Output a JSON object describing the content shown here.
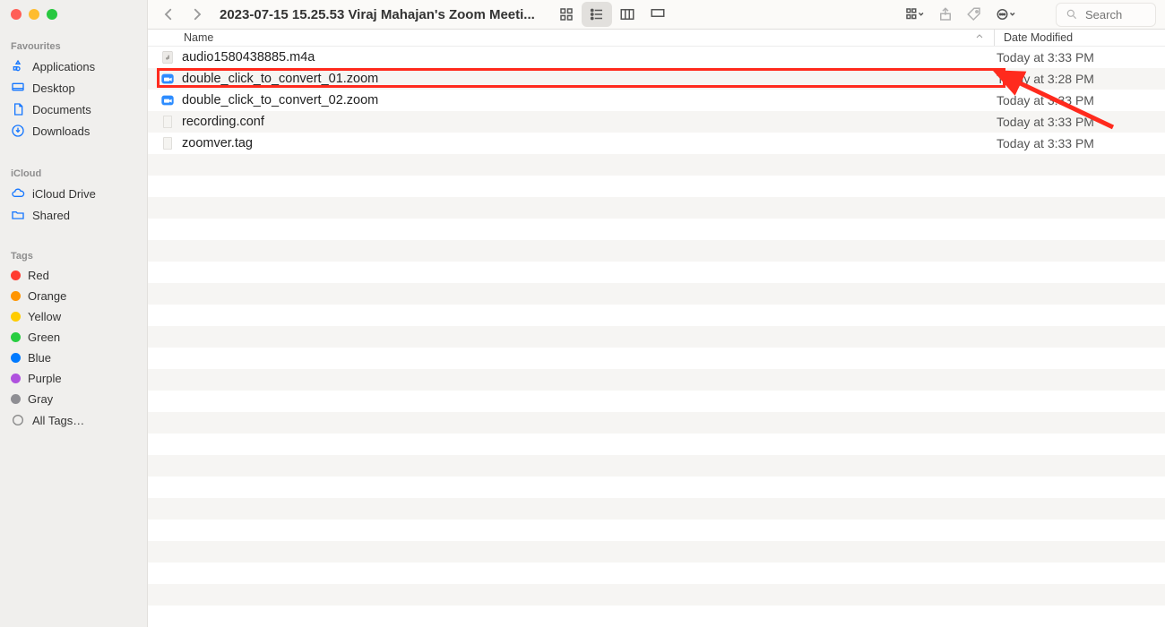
{
  "window": {
    "title": "2023-07-15 15.25.53 Viraj Mahajan's Zoom Meeti..."
  },
  "toolbar": {
    "search_placeholder": "Search"
  },
  "columns": {
    "name": "Name",
    "date": "Date Modified"
  },
  "sidebar": {
    "sections": [
      {
        "heading": "Favourites",
        "items": [
          {
            "label": "Applications",
            "icon": "apps"
          },
          {
            "label": "Desktop",
            "icon": "desktop"
          },
          {
            "label": "Documents",
            "icon": "doc"
          },
          {
            "label": "Downloads",
            "icon": "download"
          }
        ]
      },
      {
        "heading": "iCloud",
        "items": [
          {
            "label": "iCloud Drive",
            "icon": "cloud"
          },
          {
            "label": "Shared",
            "icon": "folder"
          }
        ]
      },
      {
        "heading": "Tags",
        "items": [
          {
            "label": "Red",
            "tag": "red"
          },
          {
            "label": "Orange",
            "tag": "orange"
          },
          {
            "label": "Yellow",
            "tag": "yellow"
          },
          {
            "label": "Green",
            "tag": "green"
          },
          {
            "label": "Blue",
            "tag": "blue"
          },
          {
            "label": "Purple",
            "tag": "purple"
          },
          {
            "label": "Gray",
            "tag": "gray"
          },
          {
            "label": "All Tags…",
            "tag": "all"
          }
        ]
      }
    ]
  },
  "files": [
    {
      "name": "audio1580438885.m4a",
      "icon": "audio",
      "date": "Today at 3:33 PM"
    },
    {
      "name": "double_click_to_convert_01.zoom",
      "icon": "zoom",
      "date": "Today at 3:28 PM"
    },
    {
      "name": "double_click_to_convert_02.zoom",
      "icon": "zoom",
      "date": "Today at 3:33 PM"
    },
    {
      "name": "recording.conf",
      "icon": "generic",
      "date": "Today at 3:33 PM"
    },
    {
      "name": "zoomver.tag",
      "icon": "generic",
      "date": "Today at 3:33 PM"
    }
  ],
  "annotation": {
    "highlighted_row_index": 1
  }
}
